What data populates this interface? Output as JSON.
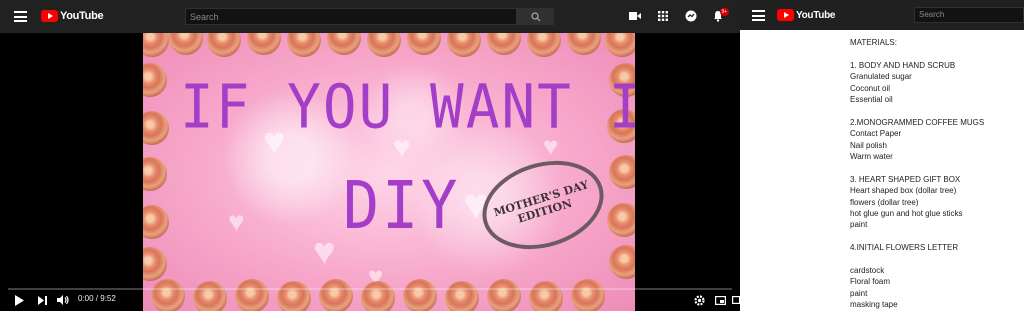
{
  "app": {
    "name": "YouTube"
  },
  "header": {
    "search_placeholder": "Search",
    "notifications_badge": "9+"
  },
  "icons": [
    "menu-icon",
    "search-icon",
    "create-video-icon",
    "apps-grid-icon",
    "messages-icon",
    "bell-icon",
    "play-icon",
    "next-icon",
    "volume-icon",
    "settings-icon",
    "miniplayer-icon",
    "theater-icon"
  ],
  "video": {
    "title_line1": "IF YOU WANT IT",
    "title_line2": "DIY",
    "stamp_line1": "MOTHER'S DAY",
    "stamp_line2": "EDITION",
    "time": "0:00 / 9:52",
    "progress": 0
  },
  "colors": {
    "brand_red": "#ff0000",
    "title_purple": "#a43ec9"
  },
  "description": {
    "lines": [
      "MATERIALS:",
      "",
      "1. BODY AND HAND SCRUB",
      "Granulated sugar",
      "Coconut oil",
      "Essential oil",
      "",
      "2.MONOGRAMMED COFFEE MUGS",
      "Contact Paper",
      "Nail polish",
      "Warm water",
      "",
      "3. HEART SHAPED GIFT BOX",
      "Heart shaped box (dollar tree)",
      "flowers (dollar tree)",
      "hot glue gun and hot glue sticks",
      "paint",
      "",
      "4.INITIAL FLOWERS LETTER",
      "",
      "cardstock",
      "Floral foam",
      "paint",
      "masking tape"
    ]
  }
}
